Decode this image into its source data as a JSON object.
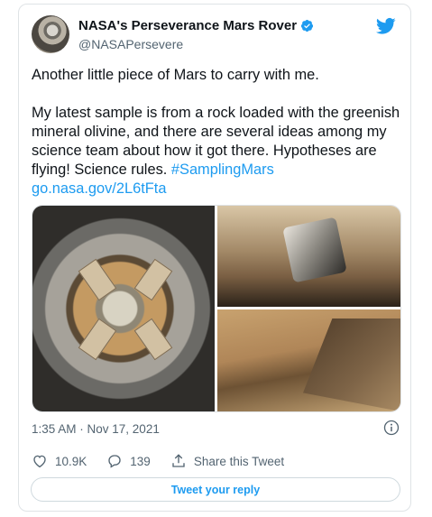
{
  "author": {
    "display_name": "NASA's Perseverance Mars Rover",
    "handle": "@NASAPersevere"
  },
  "tweet": {
    "paragraph1": "Another little piece of Mars to carry with me.",
    "paragraph2": "My latest sample is from a rock loaded with the greenish mineral olivine, and there are several ideas among my science team about how it got there. Hypotheses are flying! Science rules.",
    "hashtag": "#SamplingMars",
    "link": "go.nasa.gov/2L6tFta",
    "timestamp": "1:35 AM · Nov 17, 2021"
  },
  "actions": {
    "likes": "10.9K",
    "replies": "139",
    "share_label": "Share this Tweet"
  },
  "reply_button_label": "Tweet your reply",
  "colors": {
    "accent": "#1d9bf0",
    "text": "#0f1419",
    "secondary": "#536471"
  },
  "icons": {
    "verified": "verified-badge-icon",
    "logo": "twitter-bird-icon",
    "info": "info-icon",
    "like": "heart-icon",
    "reply": "comment-bubble-icon",
    "share": "share-upload-icon"
  }
}
